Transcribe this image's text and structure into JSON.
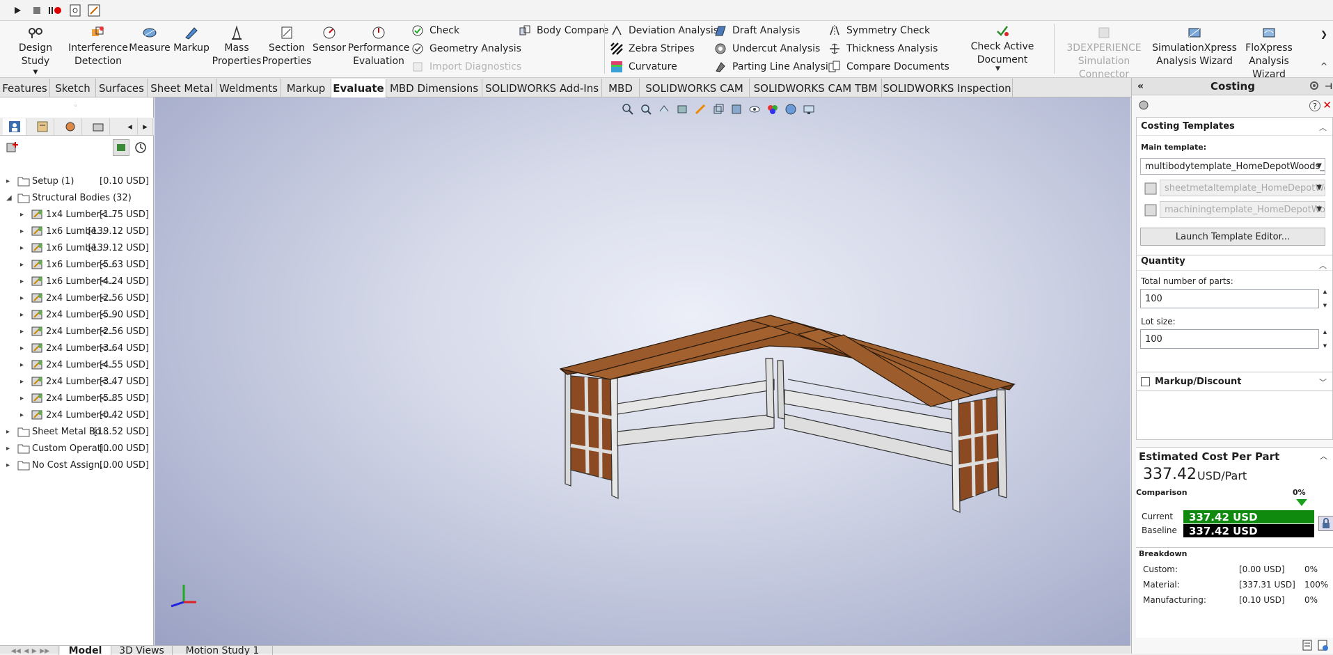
{
  "ribbon": {
    "design_study": "Design Study",
    "interference_detection": "Interference Detection",
    "measure": "Measure",
    "markup": "Markup",
    "mass_properties": "Mass Properties",
    "section_properties": "Section Properties",
    "sensor": "Sensor",
    "performance_evaluation": "Performance Evaluation",
    "check": "Check",
    "geometry_analysis": "Geometry Analysis",
    "import_diagnostics": "Import Diagnostics",
    "body_compare": "Body Compare",
    "deviation_analysis": "Deviation Analysis",
    "zebra_stripes": "Zebra Stripes",
    "curvature": "Curvature",
    "draft_analysis": "Draft Analysis",
    "undercut_analysis": "Undercut Analysis",
    "parting_line_analysis": "Parting Line Analysis",
    "symmetry_check": "Symmetry Check",
    "thickness_analysis": "Thickness Analysis",
    "compare_documents": "Compare Documents",
    "check_active_document": "Check Active Document",
    "three_dx": "3DEXPERIENCE Simulation Connector",
    "simxpress": "SimulationXpress Analysis Wizard",
    "floxpress": "FloXpress Analysis Wizard"
  },
  "tabs": [
    "Features",
    "Sketch",
    "Surfaces",
    "Sheet Metal",
    "Weldments",
    "Markup",
    "Evaluate",
    "MBD Dimensions",
    "SOLIDWORKS Add-Ins",
    "MBD",
    "SOLIDWORKS CAM",
    "SOLIDWORKS CAM TBM",
    "SOLIDWORKS Inspection"
  ],
  "active_tab": "Evaluate",
  "tree": {
    "setup": {
      "name": "Setup (1)",
      "value": "[0.10 USD]"
    },
    "structural": {
      "name": "Structural Bodies (32)"
    },
    "items": [
      {
        "name": "1x4 Lumber<...",
        "value": "[1.75 USD]"
      },
      {
        "name": "1x6 Lumbe...",
        "value": "[139.12 USD]"
      },
      {
        "name": "1x6 Lumbe...",
        "value": "[139.12 USD]"
      },
      {
        "name": "1x6 Lumber<...",
        "value": "[5.63 USD]"
      },
      {
        "name": "1x6 Lumber<...",
        "value": "[4.24 USD]"
      },
      {
        "name": "2x4 Lumber<...",
        "value": "[2.56 USD]"
      },
      {
        "name": "2x4 Lumber<...",
        "value": "[5.90 USD]"
      },
      {
        "name": "2x4 Lumber<...",
        "value": "[2.56 USD]"
      },
      {
        "name": "2x4 Lumber<...",
        "value": "[3.64 USD]"
      },
      {
        "name": "2x4 Lumber<...",
        "value": "[4.55 USD]"
      },
      {
        "name": "2x4 Lumber<...",
        "value": "[3.47 USD]"
      },
      {
        "name": "2x4 Lumber<...",
        "value": "[5.85 USD]"
      },
      {
        "name": "2x4 Lumber<...",
        "value": "[0.42 USD]"
      }
    ],
    "sheet_metal": {
      "name": "Sheet Metal Bo...",
      "value": "[18.52 USD]"
    },
    "custom_ops": {
      "name": "Custom Operati...",
      "value": "[0.00 USD]"
    },
    "no_cost": {
      "name": "No Cost Assign...",
      "value": "[0.00 USD]"
    }
  },
  "bottom_tabs": [
    "Model",
    "3D Views",
    "Motion Study 1"
  ],
  "costing": {
    "title": "Costing",
    "templates_header": "Costing Templates",
    "main_template_label": "Main template:",
    "main_template": "multibodytemplate_HomeDepotWoods_(e",
    "sheetmetal_template": "sheetmetaltemplate_HomeDepotWo",
    "machining_template": "machiningtemplate_HomeDepotWoo",
    "launch_editor": "Launch Template Editor...",
    "quantity_header": "Quantity",
    "total_parts_label": "Total number of parts:",
    "total_parts": "100",
    "lot_size_label": "Lot size:",
    "lot_size": "100",
    "markup_label": "Markup/Discount",
    "estimated_header": "Estimated Cost Per Part",
    "cost_value": "337.42",
    "cost_unit": "USD/Part",
    "comparison_label": "Comparison",
    "percent": "0%",
    "current_label": "Current",
    "current_value": "337.42 USD",
    "baseline_label": "Baseline",
    "baseline_value": "337.42 USD",
    "breakdown_label": "Breakdown",
    "breakdown": [
      {
        "label": "Custom:",
        "value": "[0.00 USD]",
        "pct": "0%"
      },
      {
        "label": "Material:",
        "value": "[337.31 USD]",
        "pct": "100%"
      },
      {
        "label": "Manufacturing:",
        "value": "[0.10 USD]",
        "pct": "0%"
      }
    ],
    "colors": {
      "current": "#0f8a0f",
      "baseline": "#000000"
    }
  }
}
